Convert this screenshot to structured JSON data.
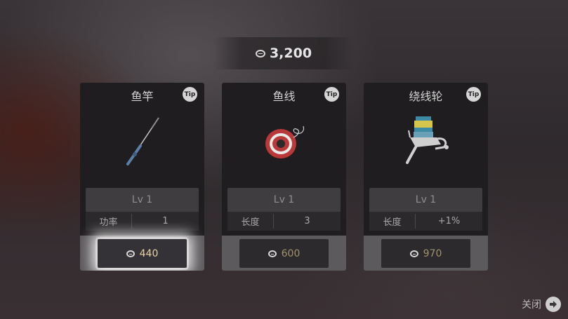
{
  "currency": {
    "icon": "coin-icon",
    "amount": "3,200"
  },
  "cards": [
    {
      "title": "鱼竿",
      "tip": "Tip",
      "icon": "fishing-rod-icon",
      "level": "Lv 1",
      "stat_label": "功率",
      "stat_value": "1",
      "price": "440",
      "highlighted": true
    },
    {
      "title": "鱼线",
      "tip": "Tip",
      "icon": "fishing-line-spool-icon",
      "level": "Lv 1",
      "stat_label": "长度",
      "stat_value": "3",
      "price": "600",
      "highlighted": false
    },
    {
      "title": "绕线轮",
      "tip": "Tip",
      "icon": "fishing-reel-icon",
      "level": "Lv 1",
      "stat_label": "长度",
      "stat_value": "+1%",
      "price": "970",
      "highlighted": false
    }
  ],
  "close": {
    "label": "关闭",
    "icon": "arrow-right-icon"
  }
}
